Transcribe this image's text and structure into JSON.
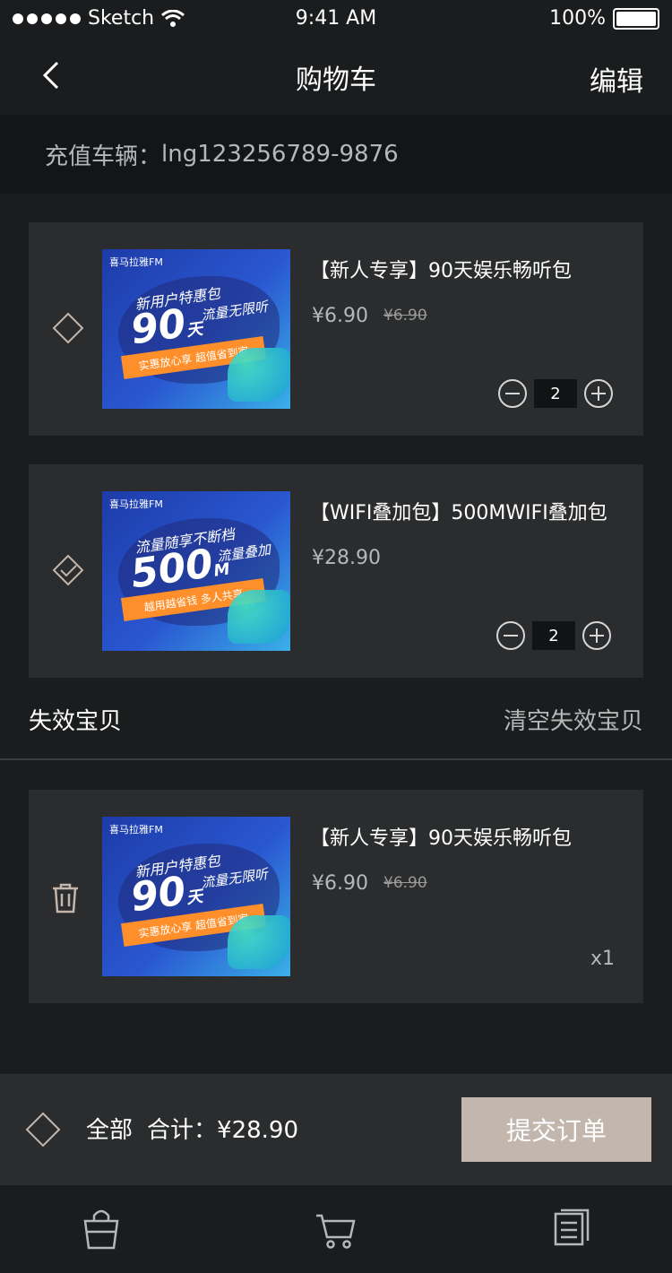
{
  "status": {
    "carrier": "Sketch",
    "time": "9:41 AM",
    "battery": "100%"
  },
  "nav": {
    "title": "购物车",
    "edit": "编辑"
  },
  "vehicle": {
    "label": "充值车辆：",
    "id": "lng123256789-9876"
  },
  "items": [
    {
      "title": "【新人专享】90天娱乐畅听包",
      "price": "¥6.90",
      "old_price": "¥6.90",
      "qty": "2",
      "selected": false,
      "art": {
        "brand": "喜马拉雅FM",
        "line1": "新用户特惠包",
        "big": "90",
        "side": "流量无限听",
        "unit": "天",
        "ribbon": "实惠放心享 超值省到家"
      }
    },
    {
      "title": "【WIFI叠加包】500MWIFI叠加包",
      "price": "¥28.90",
      "old_price": "",
      "qty": "2",
      "selected": true,
      "art": {
        "brand": "喜马拉雅FM",
        "line1": "流量随享不断档",
        "big": "500",
        "side": "流量叠加",
        "unit": "M",
        "ribbon": "越用越省钱 多人共享"
      }
    }
  ],
  "invalid": {
    "label": "失效宝贝",
    "clear": "清空失效宝贝",
    "item": {
      "title": "【新人专享】90天娱乐畅听包",
      "price": "¥6.90",
      "old_price": "¥6.90",
      "count": "x1",
      "art": {
        "brand": "喜马拉雅FM",
        "line1": "新用户特惠包",
        "big": "90",
        "side": "流量无限听",
        "unit": "天",
        "ribbon": "实惠放心享 超值省到家"
      }
    }
  },
  "bottom": {
    "all": "全部",
    "total_label": "合计：",
    "total_value": "¥28.90",
    "submit": "提交订单"
  },
  "tabbar": {
    "icons": [
      "bag-icon",
      "cart-icon",
      "list-icon"
    ]
  },
  "colors": {
    "accent": "#c3b6ac",
    "card": "#2b2c2d",
    "bg": "#1b1c1d"
  }
}
